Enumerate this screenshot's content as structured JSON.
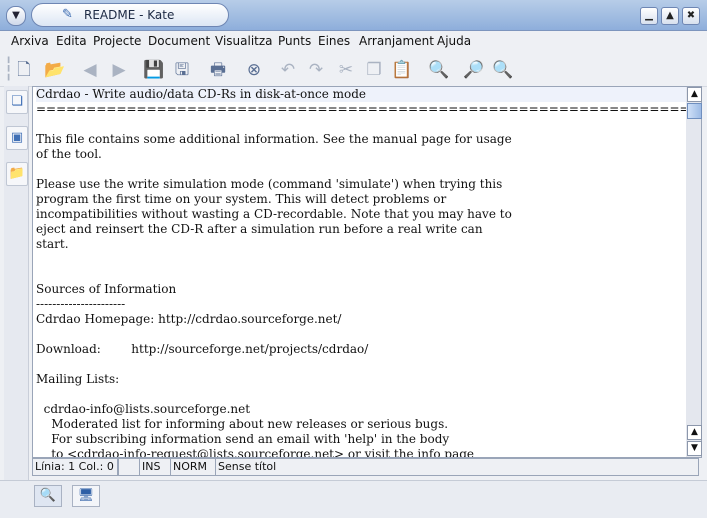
{
  "window": {
    "title": "README - Kate"
  },
  "menu": [
    "Arxiva",
    "Edita",
    "Projecte",
    "Document",
    "Visualitza",
    "Punts",
    "Eines",
    "Arranjament",
    "Ajuda"
  ],
  "editor": {
    "lines": [
      "Cdrdao - Write audio/data CD-Rs in disk-at-once mode",
      "========================================================================",
      "",
      "This file contains some additional information. See the manual page for usage",
      "of the tool.",
      "",
      "Please use the write simulation mode (command 'simulate') when trying this",
      "program the first time on your system. This will detect problems or",
      "incompatibilities without wasting a CD-recordable. Note that you may have to",
      "eject and reinsert the CD-R after a simulation run before a real write can",
      "start.",
      "",
      "",
      "Sources of Information",
      "----------------------",
      "Cdrdao Homepage: http://cdrdao.sourceforge.net/",
      "",
      "Download:        http://sourceforge.net/projects/cdrdao/",
      "",
      "Mailing Lists:",
      "",
      "  cdrdao-info@lists.sourceforge.net",
      "    Moderated list for informing about new releases or serious bugs.",
      "    For subscribing information send an email with 'help' in the body",
      "    to <cdrdao-info-request@lists.sourceforge.net> or visit the info page"
    ]
  },
  "status": {
    "position": "Línia: 1 Col.: 0",
    "blank": "",
    "mode": "INS",
    "selection": "NORM",
    "filename": "Sense títol"
  },
  "icons": {
    "window_menu": "chevron-down-icon",
    "app": "kate-icon",
    "minimize": "minimize-icon",
    "maximize": "maximize-icon",
    "close": "close-icon"
  },
  "colors": {
    "titlebar": "#9fbbe2",
    "accent": "#3f6fb5",
    "current_line": "#eef2fb"
  }
}
